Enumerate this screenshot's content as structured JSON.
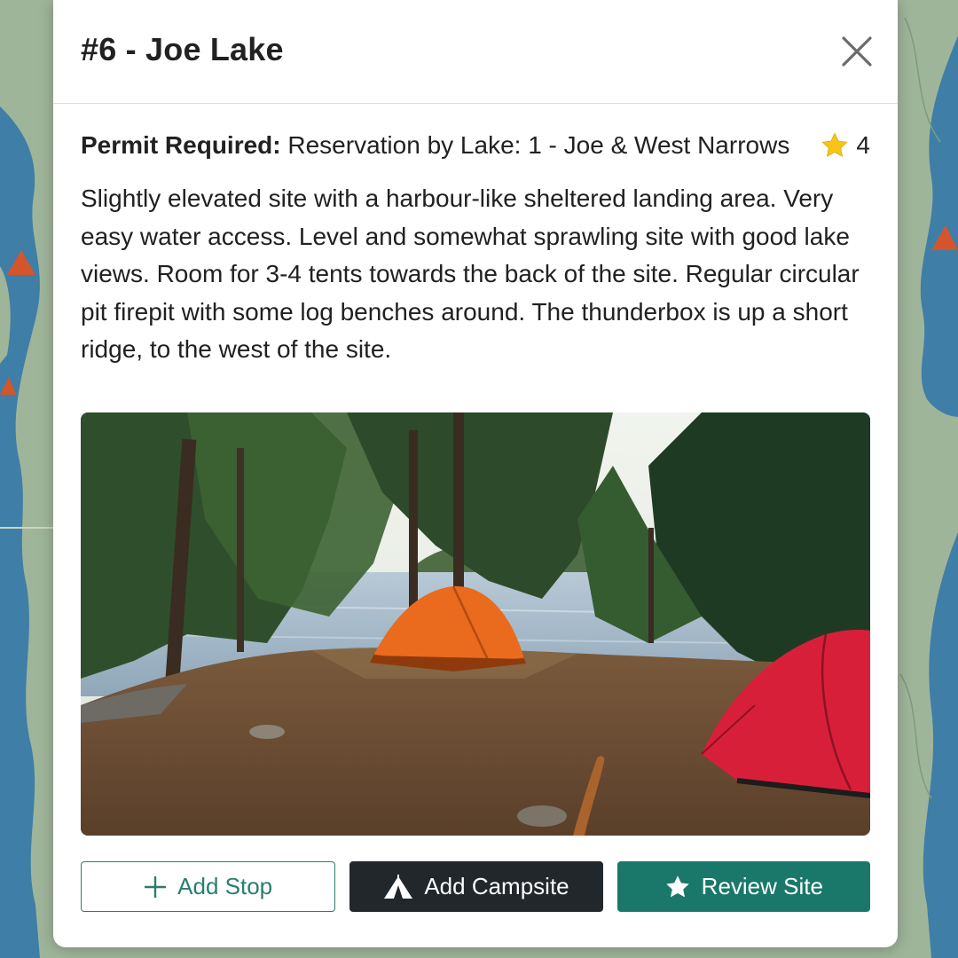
{
  "modal": {
    "title": "#6 - Joe Lake",
    "close_icon": "close-icon"
  },
  "site": {
    "permit_label": "Permit Required:",
    "permit_value": "Reservation by Lake: 1 - Joe & West Narrows",
    "rating_icon": "star-icon",
    "rating": "4",
    "description": "Slightly elevated site with a harbour-like sheltered landing area. Very easy water access. Level and somewhat sprawling site with good lake views. Room for 3-4 tents towards the back of the site. Regular circular pit firepit with some log benches around. The thunderbox is up a short ridge, to the west of the site."
  },
  "actions": {
    "add_stop": {
      "label": "Add Stop",
      "icon": "plus-icon"
    },
    "add_campsite": {
      "label": "Add Campsite",
      "icon": "tent-icon"
    },
    "review_site": {
      "label": "Review Site",
      "icon": "star-icon"
    }
  },
  "colors": {
    "map_land": "#9fb59a",
    "map_water": "#3f7ea6",
    "campsite_marker": "#d4552b",
    "primary_teal": "#19786a",
    "dark_button": "#22272b",
    "rating_star": "#f7c51a"
  }
}
